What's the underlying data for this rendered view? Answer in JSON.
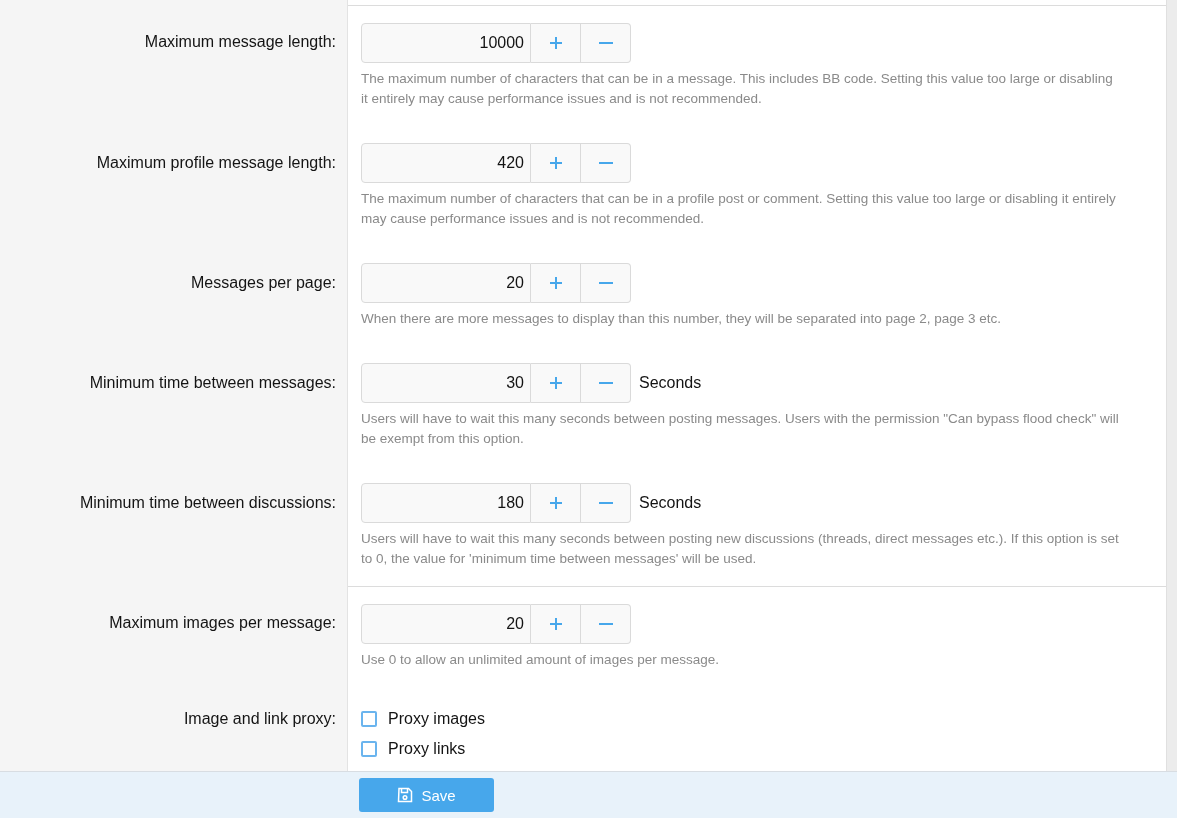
{
  "options": [
    {
      "kind": "spinner",
      "divider_before": true,
      "label": "Maximum message length:",
      "value": "10000",
      "hint": "The maximum number of characters that can be in a message. This includes BB code. Setting this value too large or disabling it entirely may cause performance issues and is not recommended."
    },
    {
      "kind": "spinner",
      "divider_before": false,
      "label": "Maximum profile message length:",
      "value": "420",
      "hint": "The maximum number of characters that can be in a profile post or comment. Setting this value too large or disabling it entirely may cause performance issues and is not recommended."
    },
    {
      "kind": "spinner",
      "divider_before": false,
      "label": "Messages per page:",
      "value": "20",
      "hint": "When there are more messages to display than this number, they will be separated into page 2, page 3 etc."
    },
    {
      "kind": "spinner",
      "divider_before": false,
      "label": "Minimum time between messages:",
      "value": "30",
      "unit": "Seconds",
      "hint": "Users will have to wait this many seconds between posting messages. Users with the permission \"Can bypass flood check\" will be exempt from this option."
    },
    {
      "kind": "spinner",
      "divider_before": false,
      "label": "Minimum time between discussions:",
      "value": "180",
      "unit": "Seconds",
      "hint": "Users will have to wait this many seconds between posting new discussions (threads, direct messages etc.). If this option is set to 0, the value for 'minimum time between messages' will be used."
    },
    {
      "kind": "spinner",
      "divider_before": true,
      "label": "Maximum images per message:",
      "value": "20",
      "hint": "Use 0 to allow an unlimited amount of images per message."
    },
    {
      "kind": "checkboxes",
      "divider_before": false,
      "label": "Image and link proxy:",
      "items": [
        {
          "label": "Proxy images",
          "checked": false
        },
        {
          "label": "Proxy links",
          "checked": false
        }
      ]
    }
  ],
  "footer": {
    "save_button": "Save"
  }
}
